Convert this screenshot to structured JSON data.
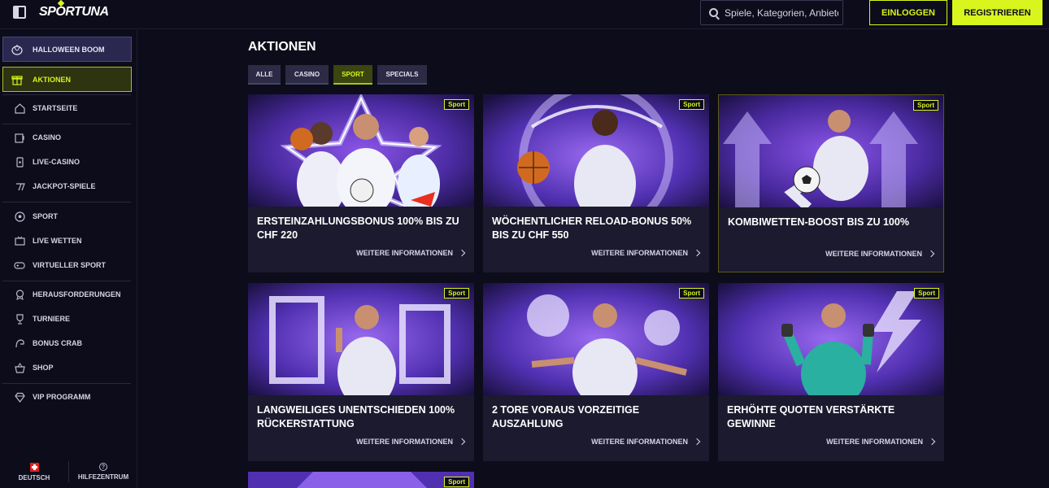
{
  "header": {
    "logo_text": "SPORTUNA",
    "search_placeholder": "Spiele, Kategorien, Anbieter",
    "login_label": "EINLOGGEN",
    "register_label": "REGISTRIEREN"
  },
  "sidebar": {
    "promos": [
      {
        "label": "HALLOWEEN BOOM",
        "icon": "pumpkin-icon"
      },
      {
        "label": "AKTIONEN",
        "icon": "gift-icon"
      }
    ],
    "items": [
      {
        "label": "STARTSEITE",
        "icon": "home-icon"
      },
      {
        "label": "CASINO",
        "icon": "slot-machine-icon"
      },
      {
        "label": "LIVE-CASINO",
        "icon": "phone-card-icon"
      },
      {
        "label": "JACKPOT-SPIELE",
        "icon": "seven-icon"
      },
      {
        "label": "SPORT",
        "icon": "soccer-ball-icon"
      },
      {
        "label": "LIVE WETTEN",
        "icon": "tv-icon"
      },
      {
        "label": "VIRTUELLER SPORT",
        "icon": "gamepad-icon"
      },
      {
        "label": "HERAUSFORDERUNGEN",
        "icon": "medal-icon"
      },
      {
        "label": "TURNIERE",
        "icon": "trophy-icon"
      },
      {
        "label": "BONUS CRAB",
        "icon": "crab-claw-icon"
      },
      {
        "label": "SHOP",
        "icon": "basket-icon"
      },
      {
        "label": "VIP PROGRAMM",
        "icon": "diamond-icon"
      }
    ],
    "footer": {
      "language": "DEUTSCH",
      "help": "HILFEZENTRUM"
    }
  },
  "main": {
    "title": "AKTIONEN",
    "tabs": [
      {
        "label": "ALLE"
      },
      {
        "label": "CASINO"
      },
      {
        "label": "SPORT"
      },
      {
        "label": "SPECIALS"
      }
    ],
    "active_tab": "SPORT",
    "cards": [
      {
        "badge": "Sport",
        "title": "ERSTEINZAHLUNGSBONUS 100% BIS ZU CHF 220",
        "link": "WEITERE INFORMATIONEN"
      },
      {
        "badge": "Sport",
        "title": "WÖCHENTLICHER RELOAD-BONUS 50% BIS ZU CHF 550",
        "link": "WEITERE INFORMATIONEN"
      },
      {
        "badge": "Sport",
        "title": "KOMBIWETTEN-BOOST BIS ZU 100%",
        "link": "WEITERE INFORMATIONEN"
      },
      {
        "badge": "Sport",
        "title": "LANGWEILIGES UNENTSCHIEDEN 100% RÜCKERSTATTUNG",
        "link": "WEITERE INFORMATIONEN"
      },
      {
        "badge": "Sport",
        "title": "2 TORE VORAUS VORZEITIGE AUSZAHLUNG",
        "link": "WEITERE INFORMATIONEN"
      },
      {
        "badge": "Sport",
        "title": "ERHÖHTE QUOTEN VERSTÄRKTE GEWINNE",
        "link": "WEITERE INFORMATIONEN"
      },
      {
        "badge": "Sport"
      }
    ]
  },
  "colors": {
    "accent": "#d8f51d",
    "background": "#0d0c1a",
    "card": "#1c1a2e",
    "purple": "#6a3fd0"
  }
}
